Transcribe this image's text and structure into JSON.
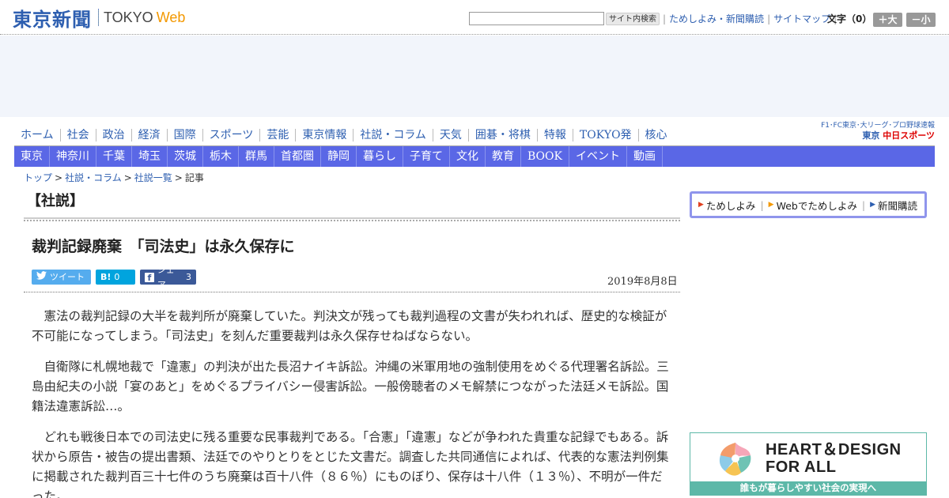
{
  "header": {
    "logo_jp": "東京新聞",
    "logo_tokyo": "TOKYO",
    "logo_web": "Web",
    "search_button": "サイト内検索",
    "links": [
      "ためしよみ・新聞購読",
      "サイトマップ"
    ],
    "font_size_label": "文字（0）",
    "font_larger": "＋大",
    "font_smaller": "－小"
  },
  "nav_primary": [
    "ホーム",
    "社会",
    "政治",
    "経済",
    "国際",
    "スポーツ",
    "芸能",
    "東京情報",
    "社説・コラム",
    "天気",
    "囲碁・将棋",
    "特報",
    "TOKYO発",
    "核心"
  ],
  "chunichi": {
    "top": "F1･FC東京･大リーグ･プロ野球速報",
    "prefix": "東京",
    "brand": "中日スポーツ"
  },
  "nav_regional": [
    "東京",
    "神奈川",
    "千葉",
    "埼玉",
    "茨城",
    "栃木",
    "群馬",
    "首都圏",
    "静岡",
    "暮らし",
    "子育て",
    "文化",
    "教育",
    "BOOK",
    "イベント",
    "動画"
  ],
  "breadcrumb": [
    "トップ",
    "社説・コラム",
    "社説一覧",
    "記事"
  ],
  "section_title": "【社説】",
  "article": {
    "title": "裁判記録廃棄　「司法史」は永久保存に",
    "date": "2019年8月8日",
    "share": {
      "tweet_label": "ツイート",
      "hatena_label": "B!",
      "hatena_count": "0",
      "facebook_label": "シェア",
      "facebook_count": "3"
    },
    "paragraphs": [
      "憲法の裁判記録の大半を裁判所が廃棄していた。判決文が残っても裁判過程の文書が失われれば、歴史的な検証が不可能になってしまう。「司法史」を刻んだ重要裁判は永久保存せねばならない。",
      "自衛隊に札幌地裁で「違憲」の判決が出た長沼ナイキ訴訟。沖縄の米軍用地の強制使用をめぐる代理署名訴訟。三島由紀夫の小説「宴のあと」をめぐるプライバシー侵害訴訟。一般傍聴者のメモ解禁につながった法廷メモ訴訟。国籍法違憲訴訟…。",
      "どれも戦後日本での司法史に残る重要な民事裁判である。「合憲」「違憲」などが争われた貴重な記録でもある。訴状から原告・被告の提出書類、法廷でのやりとりをとじた文書だ。調査した共同通信によれば、代表的な憲法判例集に掲載された裁判百三十七件のうち廃棄は百十八件（８６％）にものぼり、保存は十八件（１３％）、不明が一件だった。"
    ]
  },
  "subscribe": {
    "items": [
      "ためしよみ",
      "Webでためしよみ",
      "新聞購読"
    ]
  },
  "banner": {
    "title_line1": "HEART＆DESIGN",
    "title_line2": "FOR ALL",
    "caption": "誰もが暮らしやすい社会の実現へ"
  },
  "colors": {
    "brand_blue": "#2e5fb0",
    "nav_bar": "#5a67e6",
    "accent_orange": "#f39800",
    "banner_teal": "#5db8a8"
  }
}
